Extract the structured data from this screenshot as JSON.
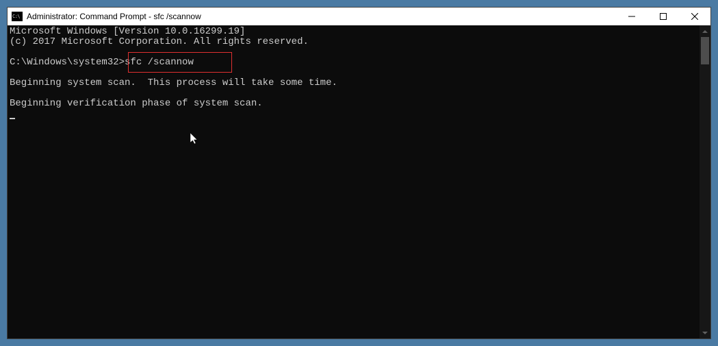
{
  "titlebar": {
    "icon_text": "C:\\",
    "title": "Administrator: Command Prompt - sfc  /scannow"
  },
  "terminal": {
    "line1": "Microsoft Windows [Version 10.0.16299.19]",
    "line2": "(c) 2017 Microsoft Corporation. All rights reserved.",
    "blank1": "",
    "prompt": "C:\\Windows\\system32>",
    "command": "sfc /scannow",
    "blank2": "",
    "line3": "Beginning system scan.  This process will take some time.",
    "blank3": "",
    "line4": "Beginning verification phase of system scan."
  }
}
